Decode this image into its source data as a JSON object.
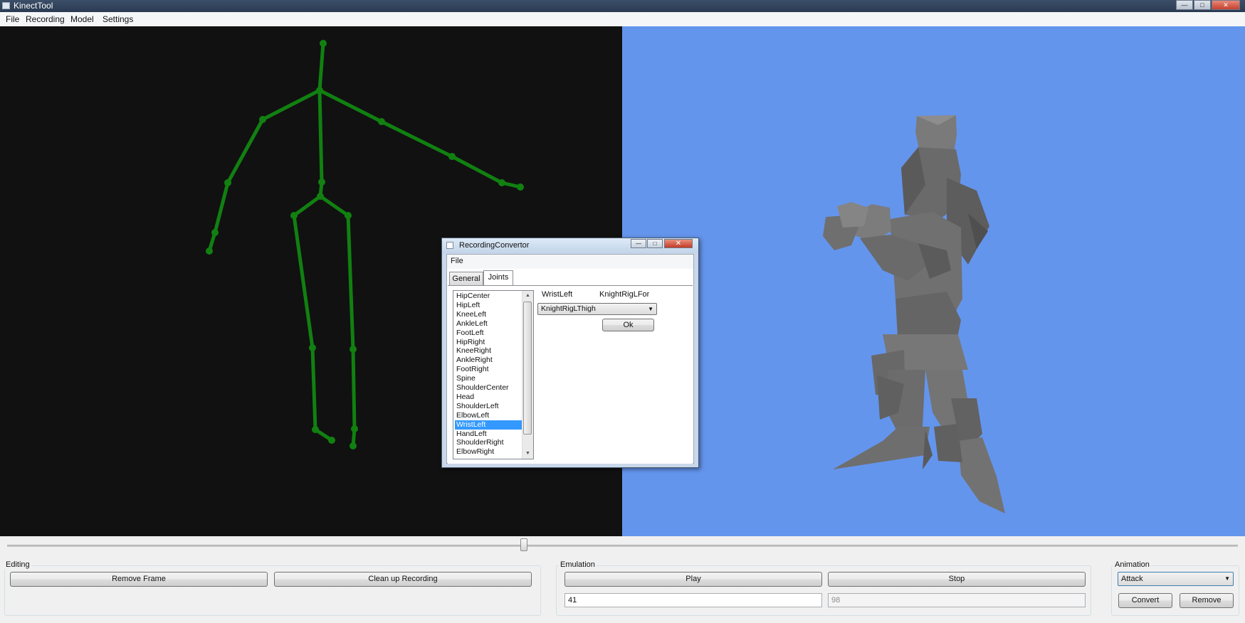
{
  "window": {
    "title": "KinectTool",
    "minimize_glyph": "—",
    "maximize_glyph": "□",
    "close_glyph": "✕"
  },
  "menu": [
    "File",
    "Recording",
    "Model",
    "Settings"
  ],
  "dialog": {
    "title": "RecordingConvertor",
    "menu_file": "File",
    "tabs": [
      "General",
      "Joints"
    ],
    "active_tab": "Joints",
    "joints": [
      "HipCenter",
      "HipLeft",
      "KneeLeft",
      "AnkleLeft",
      "FootLeft",
      "HipRight",
      "KneeRight",
      "AnkleRight",
      "FootRight",
      "Spine",
      "ShoulderCenter",
      "Head",
      "ShoulderLeft",
      "ElbowLeft",
      "WristLeft",
      "HandLeft",
      "ShoulderRight",
      "ElbowRight"
    ],
    "selected_joint": "WristLeft",
    "mapping_joint_label": "WristLeft",
    "mapping_bone_label": "KnightRigLForea",
    "bone_select": "KnightRigLThigh",
    "ok_label": "Ok"
  },
  "timeline": {
    "position": 0.42
  },
  "editing": {
    "label": "Editing",
    "remove_frame": "Remove Frame",
    "clean_up": "Clean up Recording"
  },
  "emulation": {
    "label": "Emulation",
    "play": "Play",
    "stop": "Stop",
    "current_frame": "41",
    "total_frames": "98"
  },
  "animation": {
    "label": "Animation",
    "selected": "Attack",
    "convert": "Convert",
    "remove": "Remove"
  },
  "colors": {
    "skeleton": "#118011",
    "viewport_bg_left": "#111111",
    "viewport_bg_right": "#6495ed",
    "model_gray": "#6f6f6f",
    "selection": "#3399ff"
  }
}
